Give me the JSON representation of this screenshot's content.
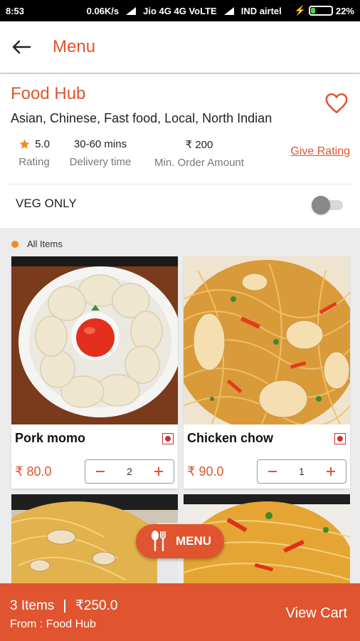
{
  "status_bar": {
    "time": "8:53",
    "speed": "0.06K/s",
    "carrier1": "Jio 4G 4G VoLTE",
    "carrier2": "IND airtel",
    "battery": "22%",
    "battery_level": 0.22
  },
  "header": {
    "title": "Menu"
  },
  "restaurant": {
    "name": "Food Hub",
    "cuisines": "Asian, Chinese, Fast food, Local, North Indian",
    "rating_value": "5.0",
    "rating_label": "Rating",
    "delivery_value": "30-60 mins",
    "delivery_label": "Delivery time",
    "min_order_value": "₹ 200",
    "min_order_label": "Min. Order Amount",
    "give_rating": "Give Rating",
    "veg_only_label": "VEG ONLY",
    "veg_only_on": false
  },
  "section": {
    "label": "All Items"
  },
  "items": [
    {
      "name": "Pork momo",
      "price": "₹ 80.0",
      "qty": "2"
    },
    {
      "name": "Chicken chow",
      "price": "₹ 90.0",
      "qty": "1"
    }
  ],
  "fab": {
    "label": "MENU"
  },
  "cart": {
    "items": "3 Items",
    "total": "₹250.0",
    "from": "From : Food Hub",
    "view_cart": "View Cart"
  },
  "colors": {
    "accent": "#e0542f",
    "nonveg": "#d32f2f",
    "star": "#f28c26"
  }
}
